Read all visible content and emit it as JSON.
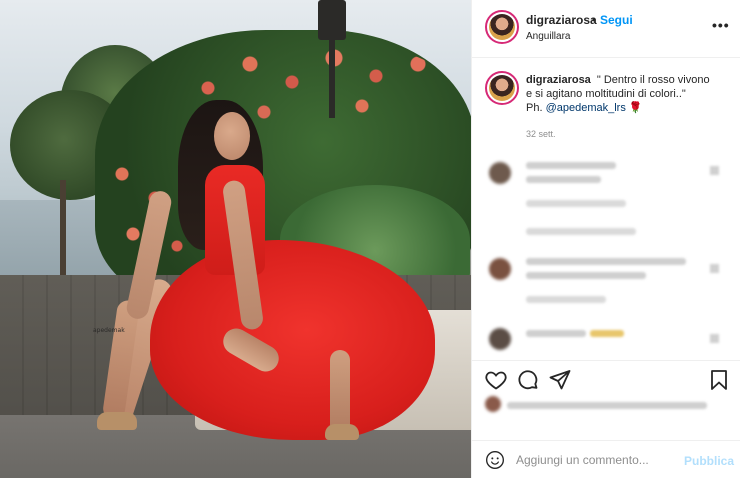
{
  "post": {
    "username": "digraziarosa",
    "dot": "•",
    "follow_label": "Segui",
    "location": "Anguillara",
    "more_label": "•••"
  },
  "caption": {
    "username": "digraziarosa",
    "text_line1": "\" Dentro il rosso vivono",
    "text_line2": "e si agitano moltitudini di colori..\"",
    "photo_prefix": "Ph. ",
    "mention": "@apedemak_lrs",
    "emoji": "🌹",
    "time": "32 sett."
  },
  "photo": {
    "watermark": "apedemak"
  },
  "icons": {
    "like": "heart-icon",
    "comment": "comment-icon",
    "share": "share-icon",
    "save": "bookmark-icon",
    "emoji": "smiley-icon",
    "more": "more-icon"
  },
  "comment_box": {
    "placeholder": "Aggiungi un commento...",
    "publish_label": "Pubblica"
  },
  "colors": {
    "follow": "#0095f6",
    "publish_disabled": "#b2dffc",
    "mention": "#00376b",
    "text": "#262626",
    "muted": "#8e8e8e"
  }
}
